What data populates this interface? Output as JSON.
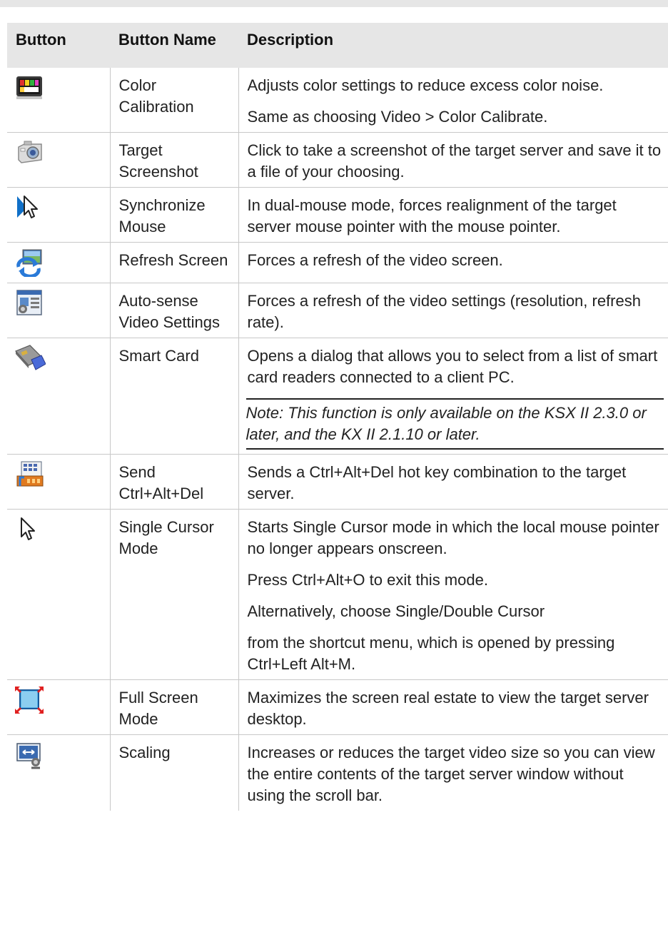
{
  "table": {
    "headers": [
      "Button",
      "Button Name",
      "Description"
    ],
    "rows": [
      {
        "icon": "color-calibration-icon",
        "name": "Color Calibration",
        "desc": [
          "Adjusts color settings to reduce excess color noise.",
          "Same as choosing Video > Color Calibrate."
        ],
        "note": ""
      },
      {
        "icon": "camera-screenshot-icon",
        "name": "Target Screenshot",
        "desc": [
          "Click to take a screenshot of the target server and save it to a file of your choosing."
        ],
        "note": ""
      },
      {
        "icon": "synchronize-mouse-icon",
        "name": "Synchronize Mouse",
        "desc": [
          "In dual-mouse mode, forces realignment of the target server mouse pointer with the mouse pointer."
        ],
        "note": ""
      },
      {
        "icon": "refresh-screen-icon",
        "name": "Refresh Screen",
        "desc": [
          "Forces a refresh of the video screen."
        ],
        "note": ""
      },
      {
        "icon": "auto-sense-video-icon",
        "name": "Auto-sense Video Settings",
        "desc": [
          "Forces a refresh of the video settings (resolution, refresh rate)."
        ],
        "note": ""
      },
      {
        "icon": "smart-card-icon",
        "name": "Smart Card",
        "desc": [
          "Opens a dialog that allows you to select from a list of smart card readers connected to a client PC."
        ],
        "note": "Note: This function is only available on the KSX II 2.3.0 or later, and the KX II 2.1.10 or later."
      },
      {
        "icon": "keyboard-send-icon",
        "name": "Send Ctrl+Alt+Del",
        "desc": [
          "Sends a Ctrl+Alt+Del hot key combination to the target server."
        ],
        "note": ""
      },
      {
        "icon": "cursor-arrow-icon",
        "name": "Single Cursor Mode",
        "desc": [
          "Starts Single Cursor mode in which the local mouse pointer no longer appears onscreen.",
          "Press Ctrl+Alt+O to exit this mode.",
          "Alternatively, choose Single/Double Cursor",
          "from the shortcut menu, which is opened by pressing Ctrl+Left Alt+M."
        ],
        "note": ""
      },
      {
        "icon": "full-screen-icon",
        "name": "Full Screen Mode",
        "desc": [
          "Maximizes the screen real estate to view the target server desktop."
        ],
        "note": ""
      },
      {
        "icon": "scaling-icon",
        "name": "Scaling",
        "desc": [
          "Increases or reduces the target video size so you can view the entire contents of the target server window without using the scroll bar."
        ],
        "note": ""
      }
    ]
  }
}
